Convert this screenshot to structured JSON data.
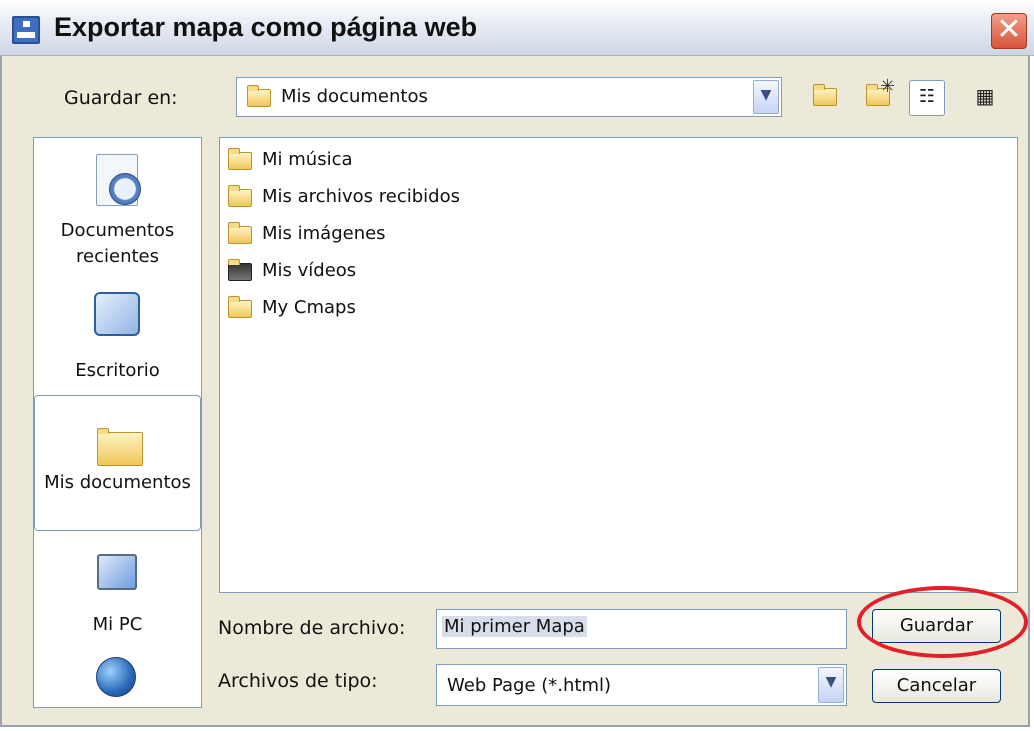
{
  "window": {
    "title": "Exportar mapa como página web",
    "close_glyph": "✕"
  },
  "save_in": {
    "label": "Guardar en:",
    "value": "Mis documentos"
  },
  "toolbar": {
    "icons": [
      "up-folder-icon",
      "new-folder-icon",
      "list-view-icon",
      "details-view-icon"
    ]
  },
  "places": [
    {
      "label_line1": "Documentos",
      "label_line2": "recientes",
      "icon": "recent-documents-icon"
    },
    {
      "label_line1": "Escritorio",
      "label_line2": "",
      "icon": "desktop-icon"
    },
    {
      "label_line1": "Mis documentos",
      "label_line2": "",
      "icon": "my-documents-icon",
      "selected": true
    },
    {
      "label_line1": "Mi PC",
      "label_line2": "",
      "icon": "my-computer-icon"
    },
    {
      "label_line1": "",
      "label_line2": "",
      "icon": "network-places-icon"
    }
  ],
  "files": [
    {
      "name": "Mi música",
      "icon": "music-folder-icon"
    },
    {
      "name": "Mis archivos recibidos",
      "icon": "folder-icon"
    },
    {
      "name": "Mis imágenes",
      "icon": "pictures-folder-icon"
    },
    {
      "name": "Mis vídeos",
      "icon": "videos-folder-icon"
    },
    {
      "name": "My Cmaps",
      "icon": "folder-icon"
    }
  ],
  "filename": {
    "label": "Nombre de archivo:",
    "value": "Mi primer Mapa"
  },
  "filetype": {
    "label": "Archivos de tipo:",
    "value": "Web Page (*.html)"
  },
  "buttons": {
    "save": "Guardar",
    "cancel": "Cancelar"
  },
  "colors": {
    "dialog_bg": "#ece9d8",
    "highlight_ring": "#e31f2a",
    "field_border": "#7f9db9"
  }
}
